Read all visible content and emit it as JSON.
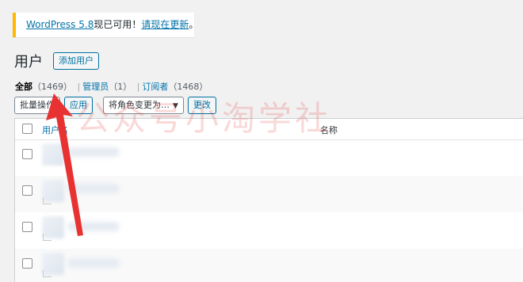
{
  "notice": {
    "link1": "WordPress 5.8",
    "text": "现已可用！",
    "link2": "请现在更新",
    "end": "。"
  },
  "page": {
    "title": "用户",
    "add_button": "添加用户"
  },
  "filters": {
    "all": {
      "label": "全部",
      "count": "（1469）"
    },
    "sep": "|",
    "admin": {
      "label": "管理员",
      "count": "（1）"
    },
    "subscriber": {
      "label": "订阅者",
      "count": "（1468）"
    }
  },
  "bulk": {
    "select": "批量操作",
    "apply": "应用",
    "role_select": "将角色变更为…",
    "change": "更改"
  },
  "table": {
    "col_username": "用户名",
    "col_name": "名称"
  },
  "overlay": {
    "watermark": "公众号小淘学社"
  },
  "colors": {
    "arrow": "#e83232",
    "notice_border": "#ffb900",
    "link": "#0073aa"
  }
}
